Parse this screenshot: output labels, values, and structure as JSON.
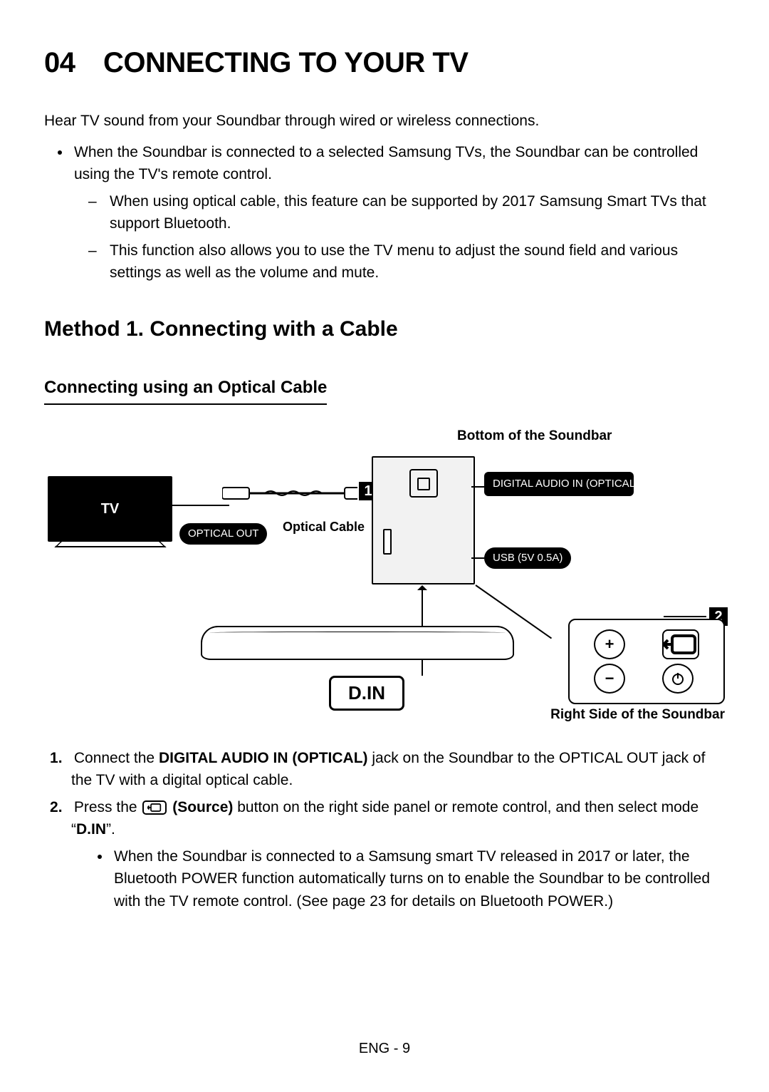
{
  "title": "04 CONNECTING TO YOUR TV",
  "intro": "Hear TV sound from your Soundbar through wired or wireless connections.",
  "bullet1": "When the Soundbar is connected to a selected Samsung TVs, the Soundbar can be controlled using the TV's remote control.",
  "sub1": "When using optical cable, this feature can be supported by 2017 Samsung Smart TVs that support Bluetooth.",
  "sub2": "This function also allows you to use the TV menu to adjust the sound field and various settings as well as the volume and mute.",
  "method_heading": "Method 1. Connecting with a Cable",
  "sub_heading": "Connecting using an Optical Cable",
  "diagram": {
    "top_label": "Bottom of the Soundbar",
    "bottom_label": "Right Side of the Soundbar",
    "tv_label": "TV",
    "optical_out": "OPTICAL OUT",
    "optical_cable": "Optical Cable",
    "digital_in": "DIGITAL AUDIO IN (OPTICAL)",
    "usb": "USB (5V 0.5A)",
    "din": "D.IN",
    "badge1": "1",
    "badge2": "2"
  },
  "step1_pre": "Connect the ",
  "step1_bold": "DIGITAL AUDIO IN (OPTICAL)",
  "step1_post": " jack on the Soundbar to the OPTICAL OUT jack of the TV with a digital optical cable.",
  "step2_pre": "Press the ",
  "step2_bold": " (Source)",
  "step2_mid": " button on the right side panel or remote control, and then select mode “",
  "step2_din": "D.IN",
  "step2_post": "”.",
  "step2_bullet": "When the Soundbar is connected to a Samsung smart TV released in 2017 or later, the Bluetooth POWER function automatically turns on to enable the Soundbar to be controlled with the TV remote control. (See page 23 for details on Bluetooth POWER.)",
  "footer": "ENG - 9"
}
